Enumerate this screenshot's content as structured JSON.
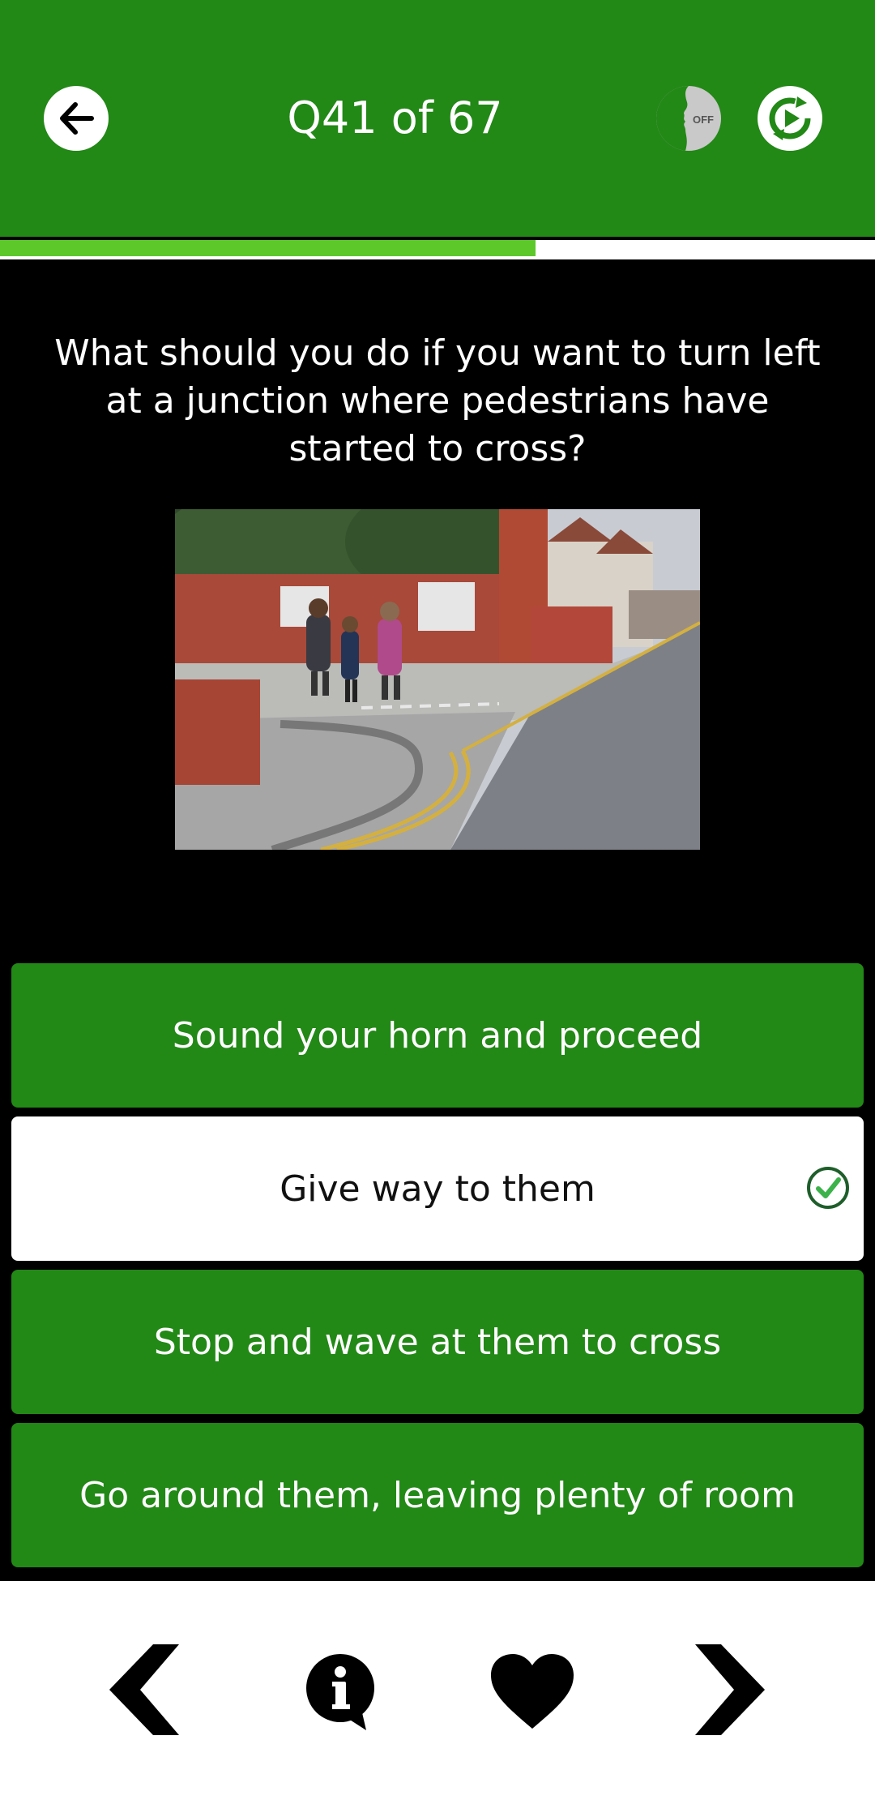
{
  "header": {
    "title": "Q41 of 67",
    "back_icon": "arrow-left-icon",
    "voice_icon": "voice-off-icon",
    "voice_label": "OFF",
    "refresh_icon": "refresh-icon",
    "background": "#228816"
  },
  "progress": {
    "current": 41,
    "total": 67,
    "fraction": 0.612,
    "color": "#5cc82a"
  },
  "question": {
    "text": "What should you do if you want to turn left at a junction where pedestrians have started to cross?",
    "image_icon": "junction-pedestrians-photo"
  },
  "answers": [
    {
      "label": "Sound your horn and proceed",
      "selected": false
    },
    {
      "label": "Give way to them",
      "selected": true,
      "icon": "check-circle-icon"
    },
    {
      "label": "Stop and wave at them to cross",
      "selected": false
    },
    {
      "label": "Go around them, leaving plenty of room",
      "selected": false
    }
  ],
  "footer": {
    "prev_icon": "chevron-left-icon",
    "info_icon": "info-bubble-icon",
    "favorite_icon": "heart-icon",
    "next_icon": "chevron-right-icon"
  }
}
